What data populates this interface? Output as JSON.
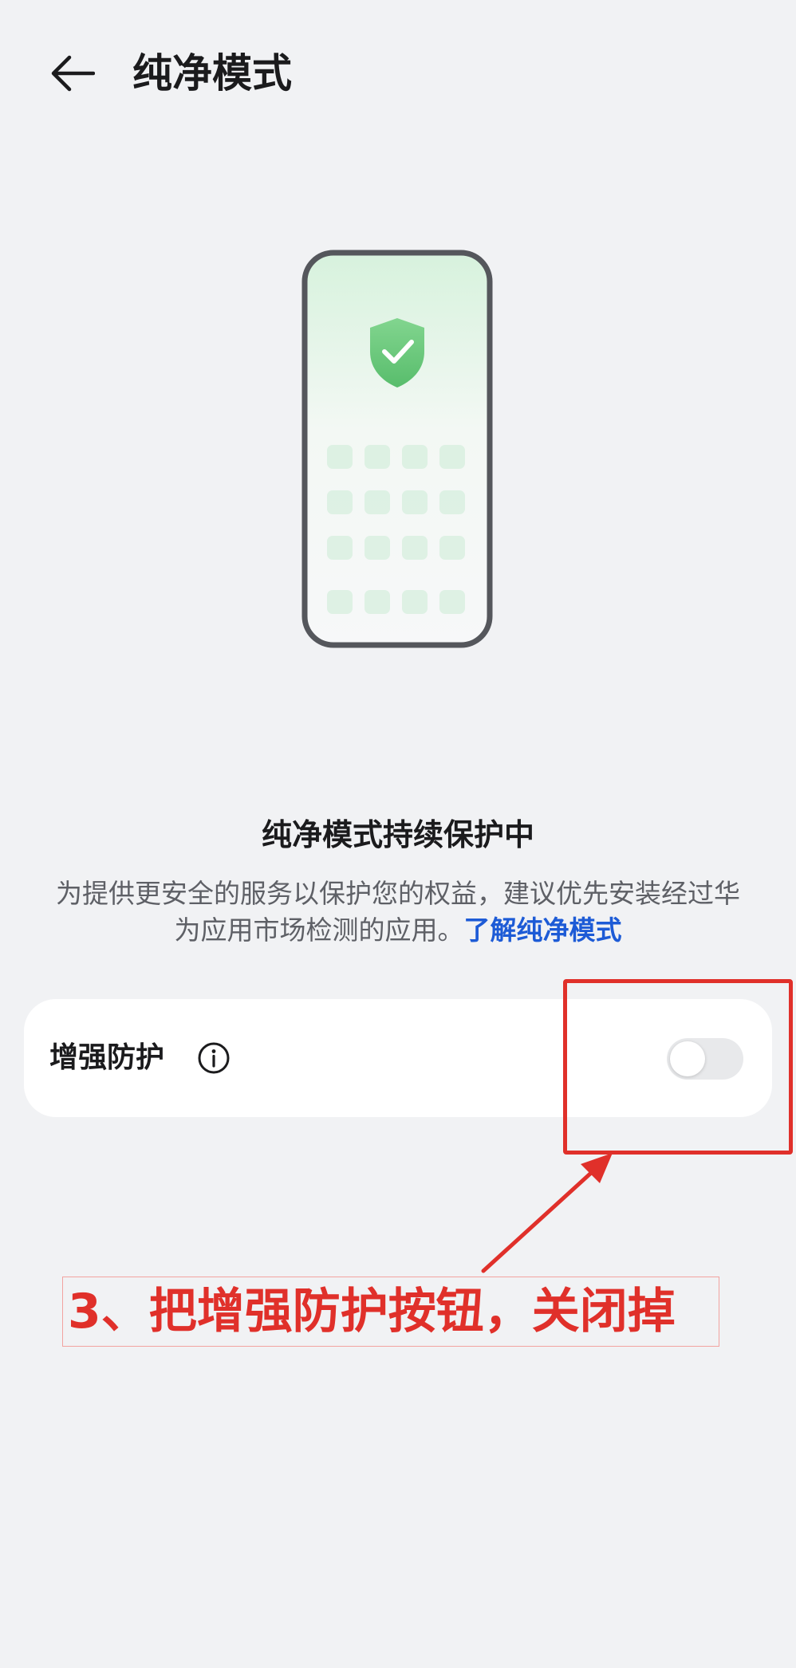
{
  "header": {
    "back_icon": "arrow-left-icon",
    "title": "纯净模式"
  },
  "illustration": {
    "icon": "shield-check-icon",
    "accent_color": "#6cc97f"
  },
  "status": {
    "title": "纯净模式持续保护中",
    "description": "为提供更安全的服务以保护您的权益，建议优先安装经过华为应用市场检测的应用。",
    "link_label": "了解纯净模式",
    "link_color": "#1d5bd6"
  },
  "settings": {
    "enhanced_protection": {
      "label": "增强防护",
      "info_icon": "info-icon",
      "toggle_on": false
    }
  },
  "annotation": {
    "text": "3、把增强防护按钮，关闭掉",
    "color": "#e0302a"
  }
}
